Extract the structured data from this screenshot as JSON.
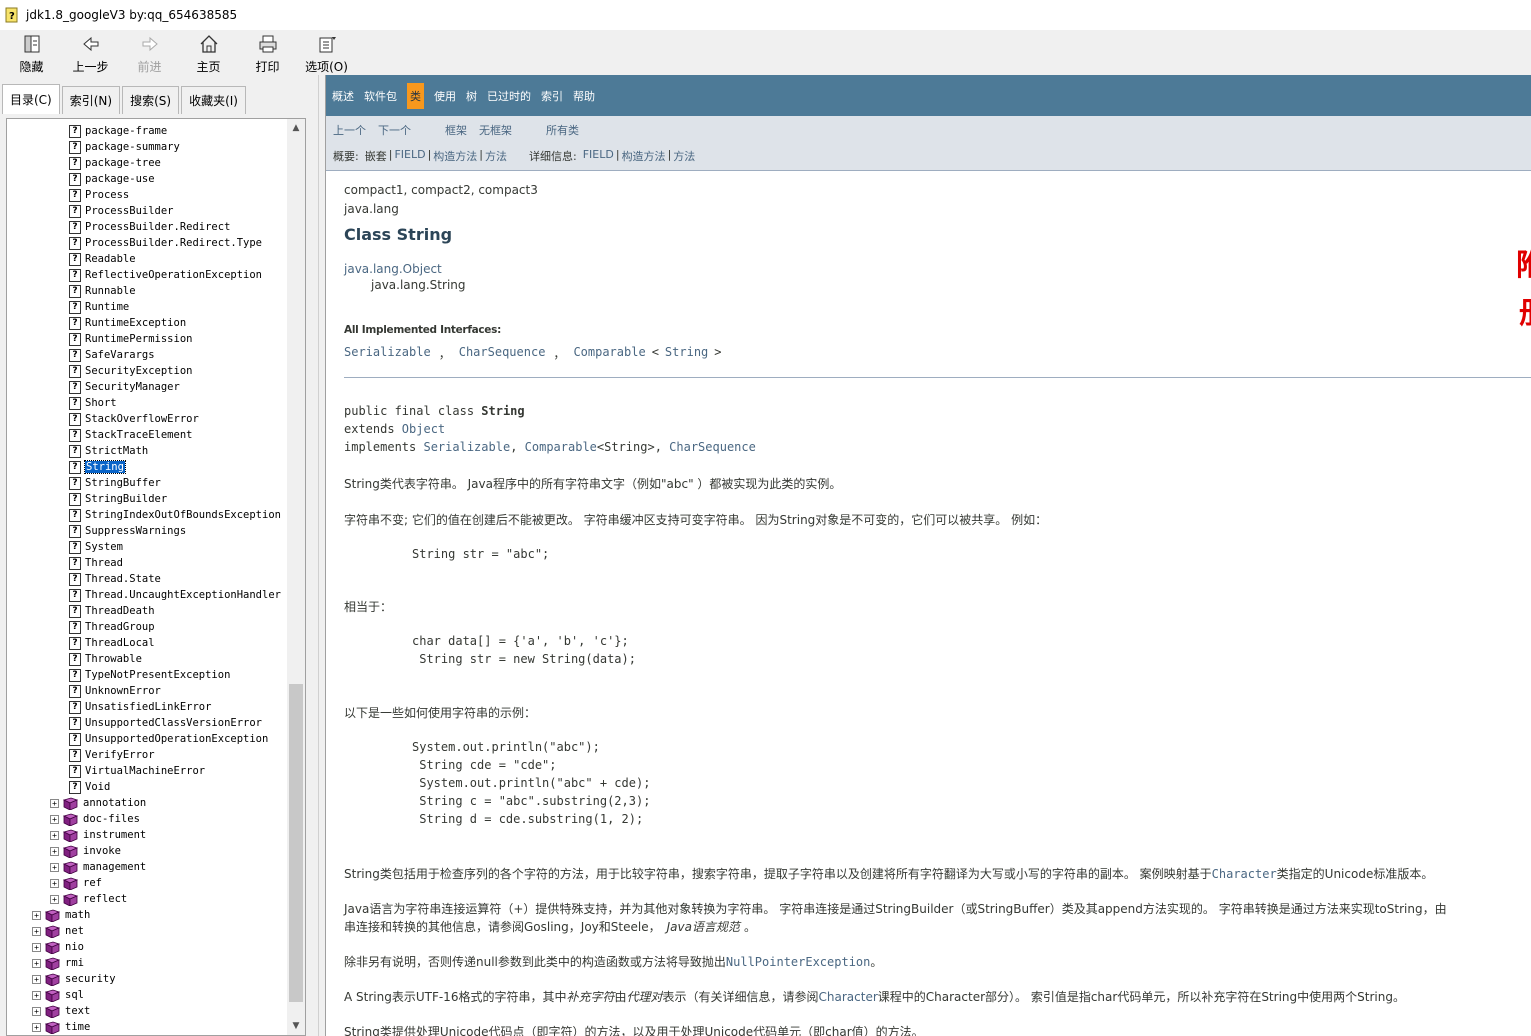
{
  "window": {
    "title": "jdk1.8_googleV3 by:qq_654638585"
  },
  "toolbar": {
    "hide": "隐藏",
    "back": "上一步",
    "forward": "前进",
    "home": "主页",
    "print": "打印",
    "options": "选项(O)"
  },
  "tabs": [
    "目录(C)",
    "索引(N)",
    "搜索(S)",
    "收藏夹(I)"
  ],
  "tree": {
    "classes": [
      "package-frame",
      "package-summary",
      "package-tree",
      "package-use",
      "Process",
      "ProcessBuilder",
      "ProcessBuilder.Redirect",
      "ProcessBuilder.Redirect.Type",
      "Readable",
      "ReflectiveOperationException",
      "Runnable",
      "Runtime",
      "RuntimeException",
      "RuntimePermission",
      "SafeVarargs",
      "SecurityException",
      "SecurityManager",
      "Short",
      "StackOverflowError",
      "StackTraceElement",
      "StrictMath",
      "String",
      "StringBuffer",
      "StringBuilder",
      "StringIndexOutOfBoundsException",
      "SuppressWarnings",
      "System",
      "Thread",
      "Thread.State",
      "Thread.UncaughtExceptionHandler",
      "ThreadDeath",
      "ThreadGroup",
      "ThreadLocal",
      "Throwable",
      "TypeNotPresentException",
      "UnknownError",
      "UnsatisfiedLinkError",
      "UnsupportedClassVersionError",
      "UnsupportedOperationException",
      "VerifyError",
      "VirtualMachineError",
      "Void"
    ],
    "selected": "String",
    "subpackages": [
      "annotation",
      "doc-files",
      "instrument",
      "invoke",
      "management",
      "ref",
      "reflect"
    ],
    "packages": [
      "math",
      "net",
      "nio",
      "rmi",
      "security",
      "sql",
      "text",
      "time"
    ]
  },
  "navbar": [
    "概述",
    "软件包",
    "类",
    "使用",
    "树",
    "已过时的",
    "索引",
    "帮助"
  ],
  "navbar_current": "类",
  "subnav": {
    "prev": "上一个",
    "next": "下一个",
    "frames": "框架",
    "noframes": "无框架",
    "allclasses": "所有类",
    "summary_label": "概要:",
    "nested": "嵌套",
    "field": "FIELD",
    "constr": "构造方法",
    "method": "方法",
    "sep": "|",
    "detail_label": "详细信息:"
  },
  "doc": {
    "profiles": "compact1, compact2, compact3",
    "package": "java.lang",
    "title": "Class String",
    "superclass": "java.lang.Object",
    "thisclass": "java.lang.String",
    "interfaces_label": "All Implemented Interfaces:",
    "iface1": "Serializable",
    "iface_sep": "，",
    "iface2": "CharSequence",
    "iface3": "Comparable",
    "iface3_lt": "<",
    "iface3_arg": "String",
    "iface3_gt": ">",
    "decl1_a": "public final class ",
    "decl1_b": "String",
    "decl2_a": "extends ",
    "decl2_b": "Object",
    "decl3_a": "implements ",
    "decl3_b": "Serializable",
    "decl3_c": ", ",
    "decl3_d": "Comparable",
    "decl3_e": "<String>, ",
    "decl3_f": "CharSequence",
    "p1": "String类代表字符串。 Java程序中的所有字符串文字（例如\"abc\" ）都被实现为此类的实例。",
    "p2": "字符串不变; 它们的值在创建后不能被更改。 字符串缓冲区支持可变字符串。 因为String对象是不可变的，它们可以被共享。 例如：",
    "code1": "String str = \"abc\";",
    "p3": "相当于：",
    "code2a": "char data[] = {'a', 'b', 'c'};",
    "code2b": " String str = new String(data);",
    "p4": "以下是一些如何使用字符串的示例：",
    "code3a": "System.out.println(\"abc\");",
    "code3b": " String cde = \"cde\";",
    "code3c": " System.out.println(\"abc\" + cde);",
    "code3d": " String c = \"abc\".substring(2,3);",
    "code3e": " String d = cde.substring(1, 2);",
    "p5a": "String类包括用于检查序列的各个字符的方法，用于比较字符串，搜索字符串，提取子字符串以及创建将所有字符翻译为大写或小写的字符串的副本。 案例映射基于",
    "p5b": "Character",
    "p5c": "类指定的Unicode标准版本。",
    "p6a": "Java语言为字符串连接运算符（+）提供特殊支持，并为其他对象转换为字符串。 字符串连接是通过StringBuilder（或StringBuffer）类及其append方法实现的。 字符串转换是通过方法来实现toString，由",
    "p6b": "串连接和转换的其他信息，请参阅Gosling，Joy和Steele，",
    "p6c": "Java语言规范",
    "p6d": "。",
    "p7a": "除非另有说明，否则传递null参数到此类中的构造函数或方法将导致抛出",
    "p7b": "NullPointerException",
    "p7c": "。",
    "p8a": "A String表示UTF-16格式的字符串，其中",
    "p8b": "补充字符",
    "p8c": "由",
    "p8d": "代理对",
    "p8e": "表示（有关详细信息，请参阅",
    "p8f": "Character",
    "p8g": "课程中的Character部分）。 索引值是指char代码单元，所以补充字符在String中使用两个String。",
    "p9": "String类提供处理Unicode代码点（即字符）的方法，以及用于处理Unicode代码单元（即char值）的方法。",
    "red1": "附",
    "red2": "册"
  },
  "colors": {
    "navbar": "#4d7a97",
    "navbar_current": "#f8981d",
    "subnav": "#dee3e9",
    "link": "#4a6782",
    "selection": "#0a64c8"
  }
}
